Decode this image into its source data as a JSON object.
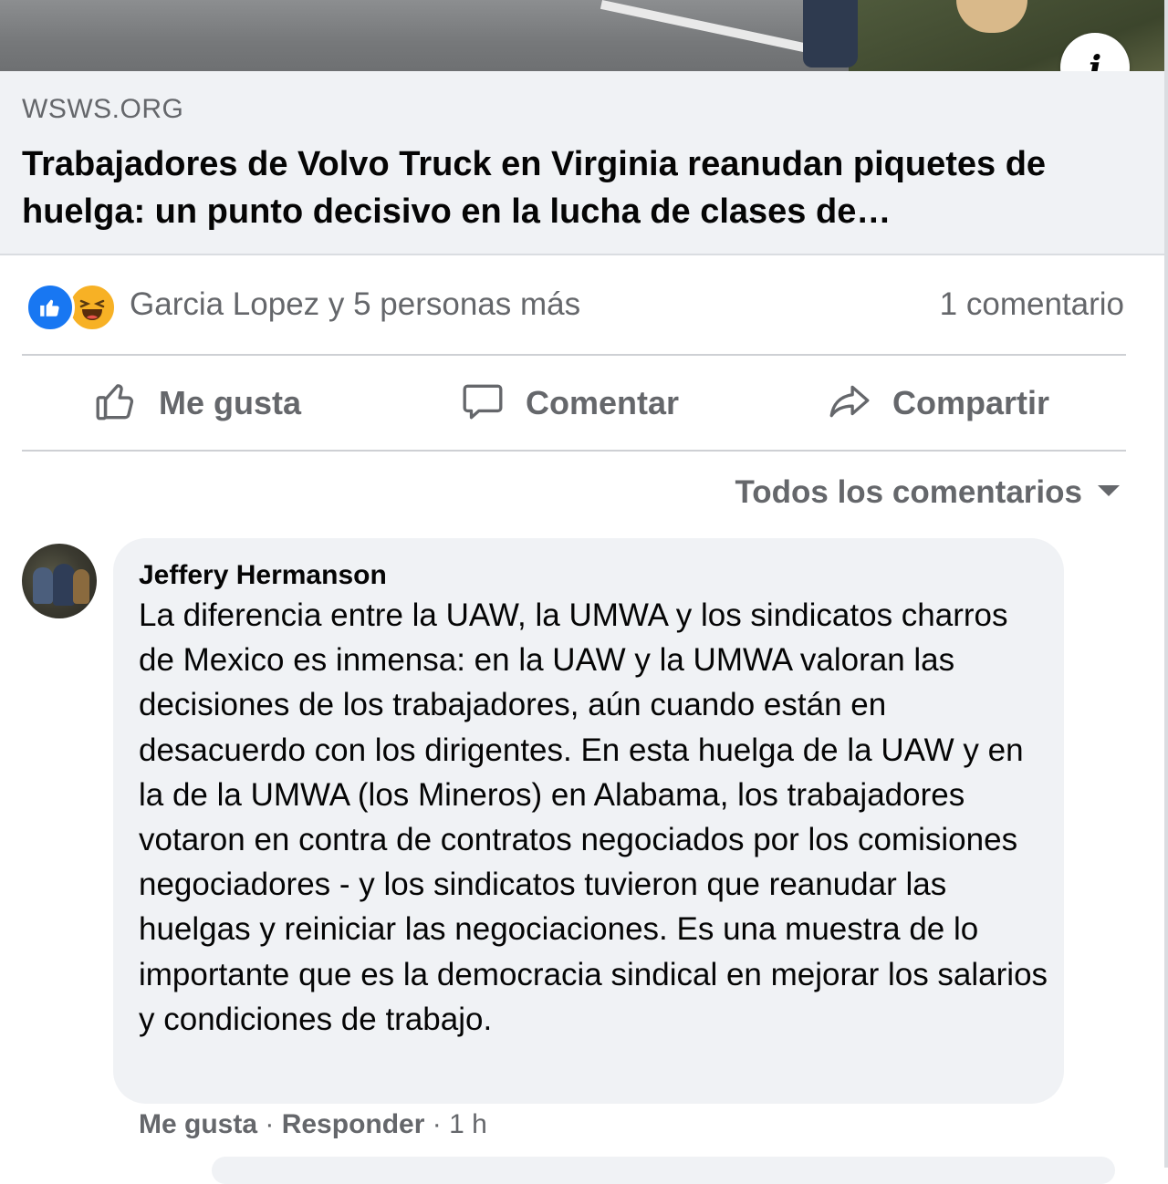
{
  "link_preview": {
    "domain": "WSWS.ORG",
    "title": "Trabajadores de Volvo Truck en Virginia reanudan piquetes de huelga: un punto decisivo en la lucha de clases de…",
    "info_icon": "info-icon"
  },
  "stats": {
    "reaction_icons": [
      "like-icon",
      "haha-icon"
    ],
    "reaction_names": "Garcia Lopez y 5 personas más",
    "comment_count": "1 comentario"
  },
  "actions": {
    "like": "Me gusta",
    "comment": "Comentar",
    "share": "Compartir"
  },
  "comments_filter": {
    "label": "Todos los comentarios"
  },
  "comment": {
    "author": "Jeffery Hermanson",
    "text": "La diferencia entre la UAW, la UMWA y los sindicatos charros de Mexico es inmensa: en la UAW y la UMWA valoran las decisiones de los trabajadores, aún cuando están en desacuerdo con los dirigentes. En esta huelga de la UAW y en la de la UMWA (los Mineros) en Alabama, los trabajadores votaron en contra de contratos negociados por los comisiones negociadores - y los sindicatos tuvieron que reanudar las huelgas y reiniciar las negociaciones. Es una muestra de lo importante que es la democracia sindical en mejorar los salarios y condiciones de trabajo.",
    "like": "Me gusta",
    "separator": " · ",
    "reply": "Responder",
    "time": "1 h"
  },
  "colors": {
    "secondary_text": "#65676b",
    "like_blue": "#1877f2",
    "haha_yellow": "#f7b125",
    "bubble_bg": "#f0f2f5"
  }
}
